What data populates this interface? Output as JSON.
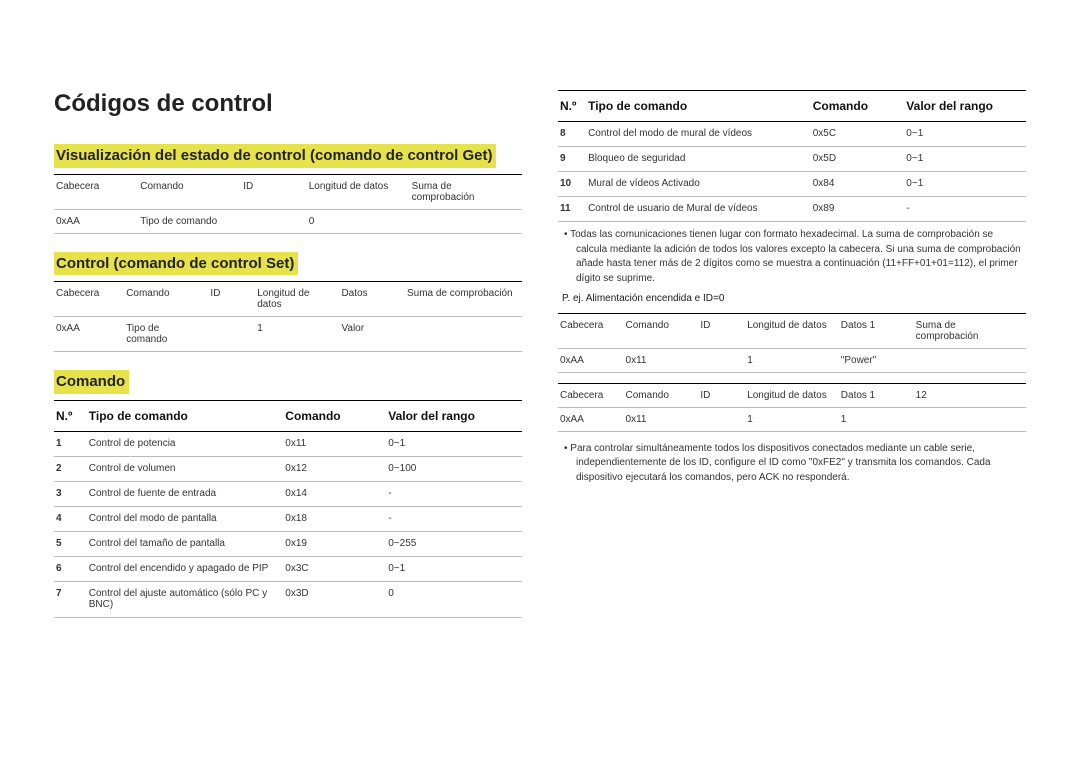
{
  "title": "Códigos de control",
  "section_get": "Visualización del estado de control (comando de control Get)",
  "section_set": "Control (comando de control Set)",
  "section_cmd": "Comando",
  "get_table": {
    "headers": [
      "Cabecera",
      "Comando",
      "ID",
      "Longitud de datos",
      "Suma de comprobación"
    ],
    "row": [
      "0xAA",
      "Tipo de comando",
      "",
      "0",
      ""
    ]
  },
  "set_table": {
    "headers": [
      "Cabecera",
      "Comando",
      "ID",
      "Longitud de datos",
      "Datos",
      "Suma de comprobación"
    ],
    "row": [
      "0xAA",
      "Tipo de comando",
      "",
      "1",
      "Valor",
      ""
    ]
  },
  "cmd_headers": {
    "no": "N.º",
    "tipo": "Tipo de comando",
    "comando": "Comando",
    "valor": "Valor del rango"
  },
  "cmds_left": [
    {
      "no": "1",
      "tipo": "Control de potencia",
      "cmd": "0x11",
      "rng": "0~1"
    },
    {
      "no": "2",
      "tipo": "Control de volumen",
      "cmd": "0x12",
      "rng": "0~100"
    },
    {
      "no": "3",
      "tipo": "Control de fuente de entrada",
      "cmd": "0x14",
      "rng": "-"
    },
    {
      "no": "4",
      "tipo": "Control del modo de pantalla",
      "cmd": "0x18",
      "rng": "-"
    },
    {
      "no": "5",
      "tipo": "Control del tamaño de pantalla",
      "cmd": "0x19",
      "rng": "0~255"
    },
    {
      "no": "6",
      "tipo": "Control del encendido y apagado de PIP",
      "cmd": "0x3C",
      "rng": "0~1"
    },
    {
      "no": "7",
      "tipo": "Control del ajuste automático (sólo PC y BNC)",
      "cmd": "0x3D",
      "rng": "0"
    }
  ],
  "cmds_right": [
    {
      "no": "8",
      "tipo": "Control del modo de mural de vídeos",
      "cmd": "0x5C",
      "rng": "0~1"
    },
    {
      "no": "9",
      "tipo": "Bloqueo de seguridad",
      "cmd": "0x5D",
      "rng": "0~1"
    },
    {
      "no": "10",
      "tipo": "Mural de vídeos Activado",
      "cmd": "0x84",
      "rng": "0~1"
    },
    {
      "no": "11",
      "tipo": "Control de usuario de Mural de vídeos",
      "cmd": "0x89",
      "rng": "-"
    }
  ],
  "bullet1": "Todas las comunicaciones tienen lugar con formato hexadecimal. La suma de comprobación se calcula mediante la adición de todos los valores excepto la cabecera. Si una suma de comprobación añade hasta tener más de 2 dígitos como se muestra a continuación (11+FF+01+01=112), el primer dígito se suprime.",
  "example_label": "P. ej. Alimentación encendida e ID=0",
  "ex1": {
    "headers": [
      "Cabecera",
      "Comando",
      "ID",
      "Longitud de datos",
      "Datos 1",
      "Suma de comprobación"
    ],
    "row": [
      "0xAA",
      "0x11",
      "",
      "1",
      "\"Power\"",
      ""
    ]
  },
  "ex2": {
    "headers": [
      "Cabecera",
      "Comando",
      "ID",
      "Longitud de datos",
      "Datos 1",
      "12"
    ],
    "row": [
      "0xAA",
      "0x11",
      "",
      "1",
      "1",
      ""
    ]
  },
  "bullet2": "Para controlar simultáneamente todos los dispositivos conectados mediante un cable serie, independientemente de los ID, configure el ID como \"0xFE2\" y transmita los comandos. Cada dispositivo ejecutará los comandos, pero ACK no responderá."
}
